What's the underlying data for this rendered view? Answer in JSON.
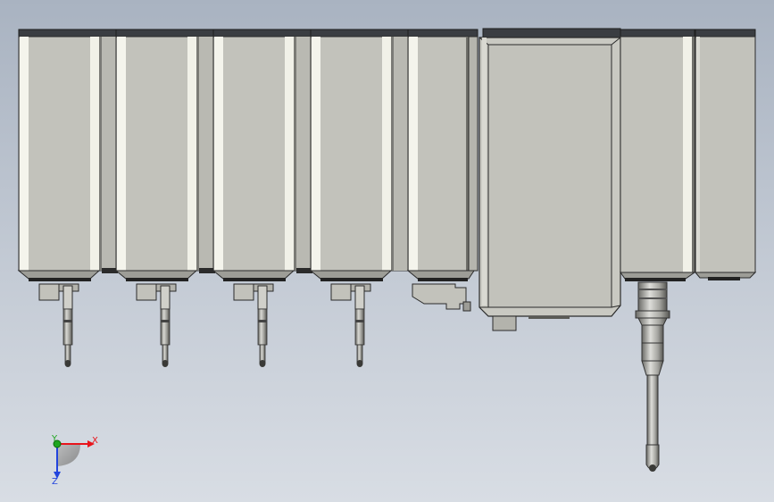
{
  "viewport": {
    "background_top": "#a9b3c1",
    "background_bottom": "#d8dde4"
  },
  "model": {
    "housing_color": "#c2c2bb",
    "highlight_color": "#f4f4ec",
    "edge_color": "#2b2b2b",
    "top_strip_color": "#3a3d42",
    "probe_color": "#8f8f8a"
  },
  "triad": {
    "x_label": "X",
    "y_label": "Y",
    "z_label": "Z",
    "x_color": "#e8141b",
    "y_color": "#1fa51f",
    "z_color": "#2244dd"
  }
}
